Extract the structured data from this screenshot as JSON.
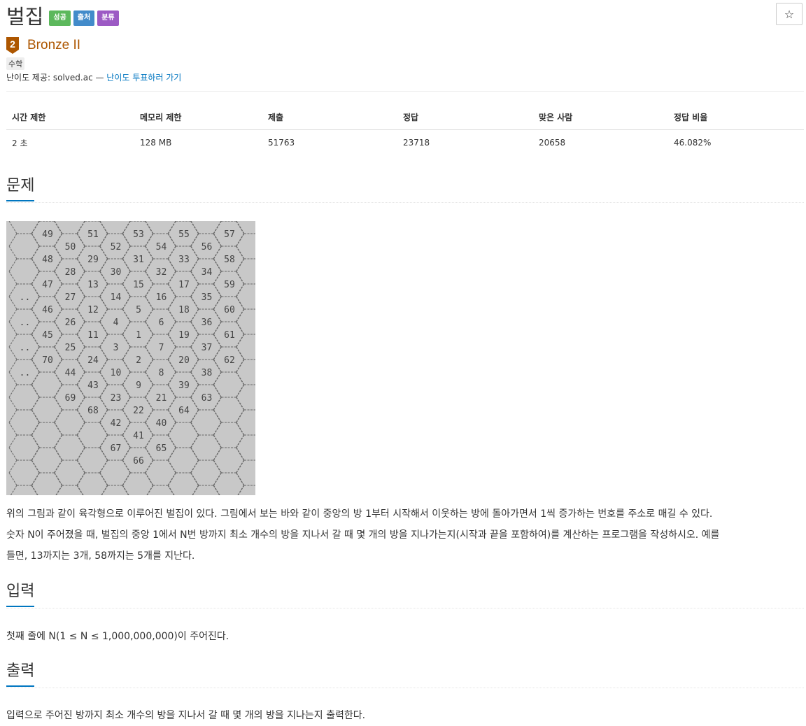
{
  "header": {
    "title": "벌집",
    "badges": [
      "성공",
      "출처",
      "분류"
    ],
    "star": "☆"
  },
  "tier": {
    "number": "2",
    "name": "Bronze II"
  },
  "tag": "수학",
  "provider": {
    "prefix": "난이도 제공: solved.ac — ",
    "link": "난이도 투표하러 가기"
  },
  "stats": {
    "headers": [
      "시간 제한",
      "메모리 제한",
      "제출",
      "정답",
      "맞은 사람",
      "정답 비율"
    ],
    "values": [
      "2 초",
      "128 MB",
      "51763",
      "23718",
      "20658",
      "46.082%"
    ]
  },
  "sections": {
    "problem": {
      "title": "문제",
      "lines": [
        "위의 그림과 같이 육각형으로 이루어진 벌집이 있다. 그림에서 보는 바와 같이 중앙의 방 1부터 시작해서 이웃하는 방에 돌아가면서 1씩 증가하는 번호를 주소로 매길 수 있다.",
        "숫자 N이 주어졌을 때, 벌집의 중앙 1에서 N번 방까지 최소 개수의 방을 지나서 갈 때 몇 개의 방을 지나가는지(시작과 끝을 포함하여)를 계산하는 프로그램을 작성하시오. 예를",
        "들면, 13까지는 3개, 58까지는 5개를 지난다."
      ]
    },
    "input": {
      "title": "입력",
      "text": "첫째 줄에 N(1 ≤ N ≤ 1,000,000,000)이 주어진다."
    },
    "output": {
      "title": "출력",
      "text": "입력으로 주어진 방까지 최소 개수의 방을 지나서 갈 때 몇 개의 방을 지나는지 출력한다."
    }
  },
  "figure": {
    "columns": [
      [
        "",
        "",
        "",
        "..",
        "..",
        "..",
        "..",
        "",
        "",
        ""
      ],
      [
        "49",
        "48",
        "47",
        "46",
        "45",
        "70",
        "",
        "",
        "",
        ""
      ],
      [
        "",
        "50",
        "28",
        "27",
        "26",
        "25",
        "44",
        "69",
        "",
        ""
      ],
      [
        "51",
        "29",
        "13",
        "12",
        "11",
        "24",
        "43",
        "68",
        "",
        ""
      ],
      [
        "",
        "52",
        "30",
        "14",
        "4",
        "3",
        "10",
        "23",
        "42",
        "67"
      ],
      [
        "53",
        "31",
        "15",
        "5",
        "1",
        "2",
        "9",
        "22",
        "41",
        "66"
      ],
      [
        "",
        "54",
        "32",
        "16",
        "6",
        "7",
        "8",
        "21",
        "40",
        "65"
      ],
      [
        "55",
        "33",
        "17",
        "18",
        "19",
        "20",
        "39",
        "64",
        "",
        ""
      ],
      [
        "",
        "56",
        "34",
        "35",
        "36",
        "37",
        "38",
        "63",
        "",
        ""
      ],
      [
        "57",
        "58",
        "59",
        "60",
        "61",
        "62",
        "",
        "",
        "",
        ""
      ],
      [
        "",
        "",
        "",
        "",
        "",
        "",
        "",
        "",
        "",
        ""
      ]
    ]
  }
}
